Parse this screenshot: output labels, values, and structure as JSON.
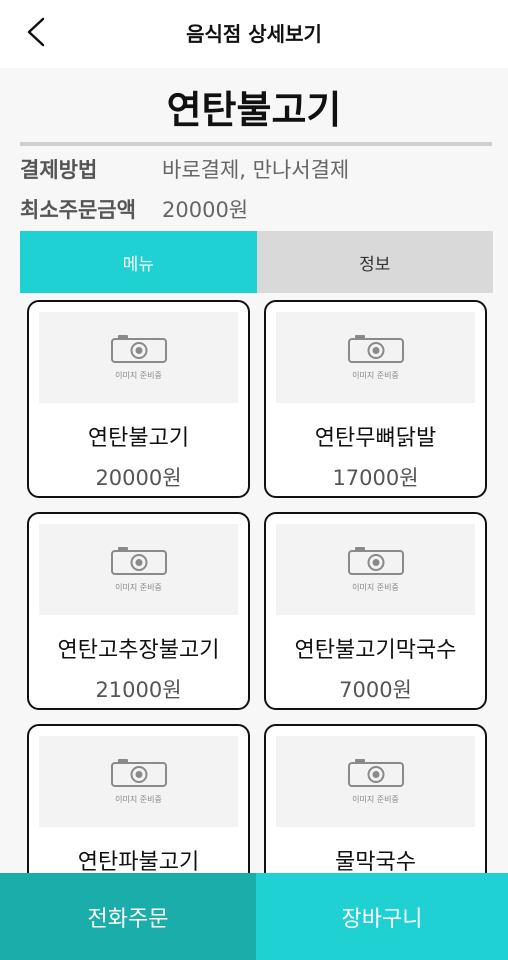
{
  "header": {
    "title": "음식점 상세보기",
    "back_icon": "chevron-left-icon"
  },
  "restaurant": {
    "name": "연탄불고기",
    "payment_label": "결제방법",
    "payment_value": "바로결제, 만나서결제",
    "min_order_label": "최소주문금액",
    "min_order_value": "20000원"
  },
  "tabs": [
    {
      "label": "메뉴",
      "active": true
    },
    {
      "label": "정보",
      "active": false
    }
  ],
  "placeholder_text": "이미지 준비중",
  "menu_items": [
    {
      "name": "연탄불고기",
      "price": "20000원"
    },
    {
      "name": "연탄무뼈닭발",
      "price": "17000원"
    },
    {
      "name": "연탄고추장불고기",
      "price": "21000원"
    },
    {
      "name": "연탄불고기막국수",
      "price": "7000원"
    },
    {
      "name": "연탄파불고기",
      "price": ""
    },
    {
      "name": "물막국수",
      "price": ""
    }
  ],
  "bottom": {
    "phone_order_label": "전화주문",
    "cart_label": "장바구니"
  },
  "colors": {
    "accent": "#1fd1d3",
    "phone_button": "#1aadaa",
    "cart_button": "#1fd1d3",
    "tab_inactive": "#d9d9d9"
  }
}
